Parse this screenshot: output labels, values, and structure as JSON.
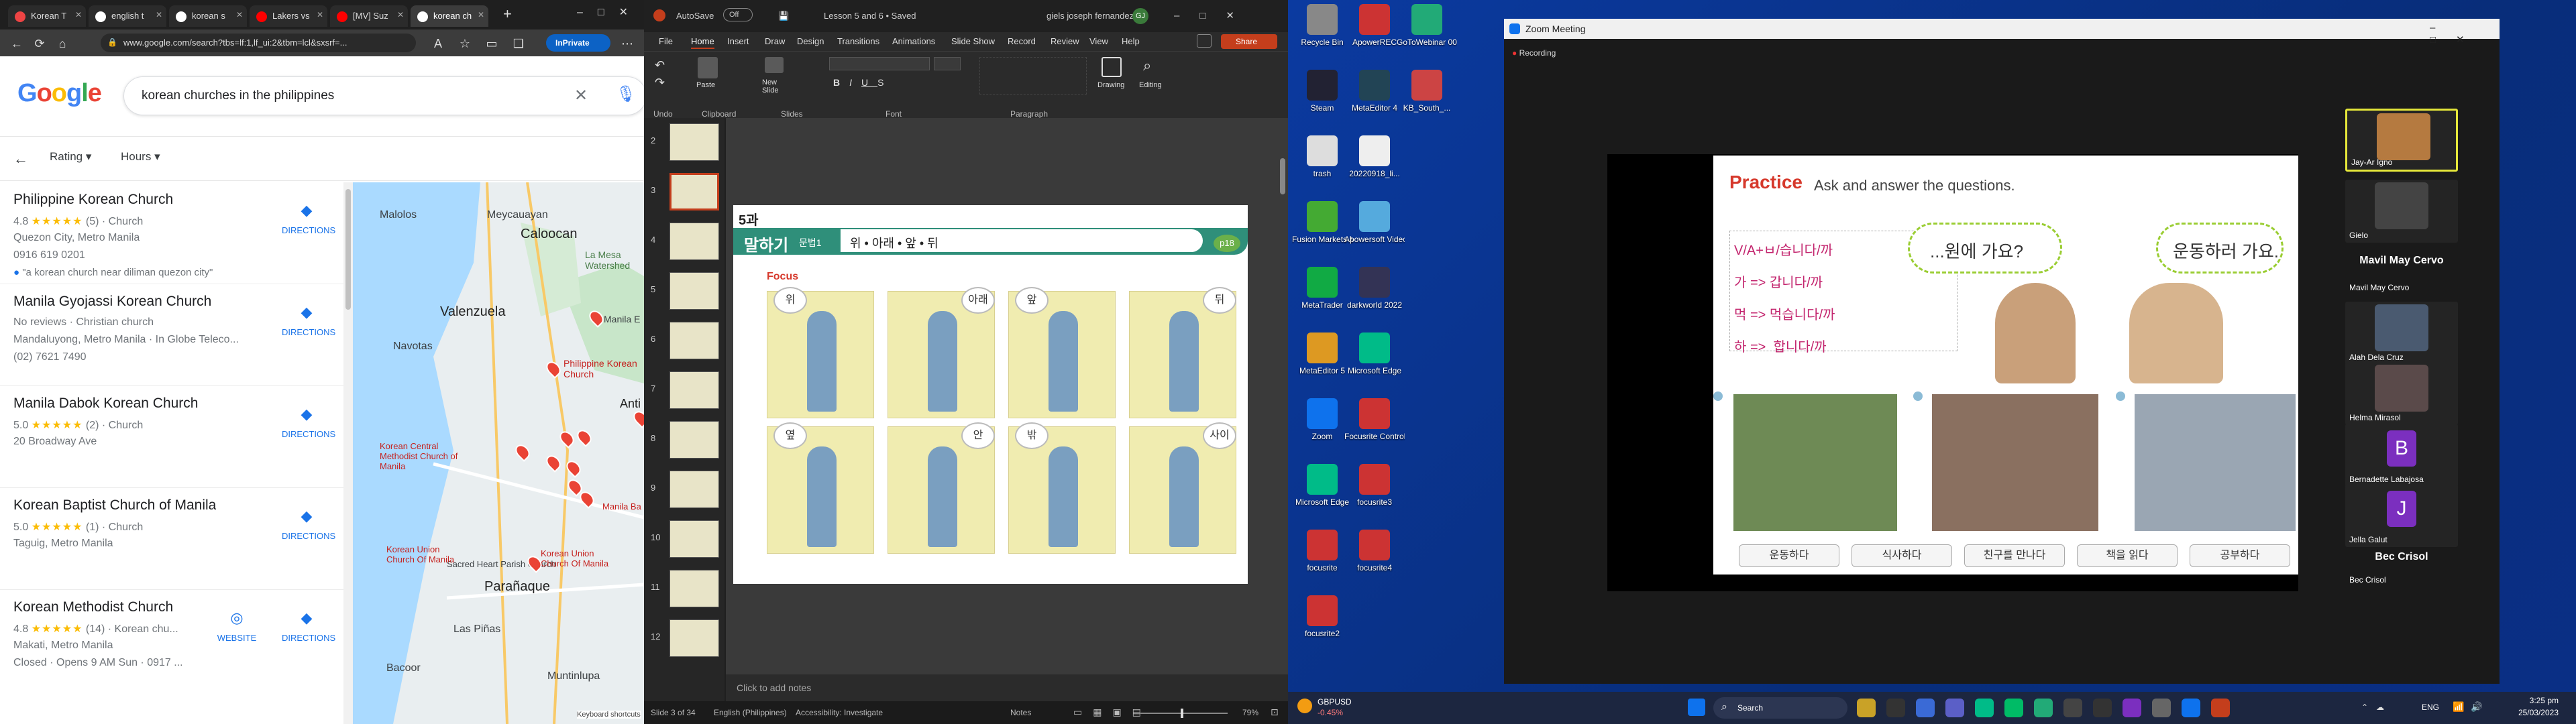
{
  "browser": {
    "tabs": [
      "Korean T",
      "english t",
      "korean s",
      "Lakers vs",
      "[MV] Suz",
      "korean ch"
    ],
    "url": "www.google.com/search?tbs=lf:1,lf_ui:2&tbm=lcl&sxsrf=...",
    "inprivate": "InPrivate",
    "google_logo": "Google",
    "query": "korean churches in the philippines",
    "filters": {
      "rating": "Rating",
      "hours": "Hours"
    },
    "results": [
      {
        "name": "Philippine Korean Church",
        "rating": "4.8",
        "stars": "★★★★★",
        "count": "(5)",
        "type": "Church",
        "address": "Quezon City, Metro Manila",
        "extra": "0916 619 0201",
        "snippet": "\"a korean church near diliman quezon city\"",
        "directions": "DIRECTIONS"
      },
      {
        "name": "Manila Gyojassi Korean Church",
        "rating": "No reviews",
        "stars": "",
        "count": "",
        "type": "Christian church",
        "address": "Mandaluyong, Metro Manila · In Globe Teleco...",
        "extra": "(02) 7621 7490",
        "snippet": "",
        "directions": "DIRECTIONS"
      },
      {
        "name": "Manila Dabok Korean Church",
        "rating": "5.0",
        "stars": "★★★★★",
        "count": "(2)",
        "type": "Church",
        "address": "20 Broadway Ave",
        "extra": "",
        "snippet": "",
        "directions": "DIRECTIONS"
      },
      {
        "name": "Korean Baptist Church of Manila",
        "rating": "5.0",
        "stars": "★★★★★",
        "count": "(1)",
        "type": "Church",
        "address": "Taguig, Metro Manila",
        "extra": "",
        "snippet": "",
        "directions": "DIRECTIONS"
      },
      {
        "name": "Korean Methodist Church",
        "rating": "4.8",
        "stars": "★★★★★",
        "count": "(14)",
        "type": "Korean chu...",
        "address": "Makati, Metro Manila",
        "extra": "Closed · Opens 9 AM Sun · 0917 ...",
        "snippet": "",
        "directions": "DIRECTIONS",
        "website": "WEBSITE"
      }
    ],
    "map_labels": [
      "Malolos",
      "Meycauayan",
      "Caloocan",
      "La Mesa Watershed",
      "Valenzuela",
      "Navotas",
      "Manila E",
      "Philippine Korean Church",
      "Anti",
      "Korean Central Methodist Church of Manila",
      "Manila Ba",
      "Sacred Heart Parish Church",
      "Korean Union Church Of Manila",
      "Korean Union Church Of Manila",
      "Parañaque",
      "Las Piñas",
      "Bacoor",
      "Muntinlupa",
      "Keyboard shortcuts"
    ]
  },
  "ppt": {
    "autosave": "AutoSave",
    "autosave_state": "Off",
    "doc_title": "Lesson 5 and 6 • Saved",
    "user": "giels joseph fernandez",
    "menu": [
      "File",
      "Home",
      "Insert",
      "Draw",
      "Design",
      "Transitions",
      "Animations",
      "Slide Show",
      "Record",
      "Review",
      "View",
      "Help"
    ],
    "share": "Share",
    "groups": [
      "Undo",
      "Clipboard",
      "Slides",
      "Font",
      "Paragraph",
      "Drawing",
      "Editing"
    ],
    "ribbon_btns": {
      "paste": "Paste",
      "new_slide": "New Slide",
      "drawing": "Drawing",
      "editing": "Editing"
    },
    "thumb_numbers": [
      "2",
      "3",
      "4",
      "5",
      "6",
      "7",
      "8",
      "9",
      "10",
      "11",
      "12"
    ],
    "slide": {
      "lesson_no": "5과",
      "header_ko": "말하기",
      "header_sub": "문법1",
      "header_words": "위 • 아래 • 앞 • 뒤",
      "page": "p18",
      "focus": "Focus",
      "bubbles_top": [
        "위",
        "아래",
        "앞",
        "뒤"
      ],
      "bubbles_bottom": [
        "옆",
        "안",
        "밖",
        "사이"
      ]
    },
    "notes": "Click to add notes",
    "status": {
      "slide": "Slide 3 of 34",
      "lang": "English (Philippines)",
      "access": "Accessibility: Investigate",
      "notes": "Notes",
      "zoom": "79%"
    }
  },
  "desktop": {
    "icons": [
      "Recycle Bin",
      "ApowerREC",
      "GoToWebinar 001",
      "Steam",
      "MetaEditor 4",
      "KB_South_...",
      "trash",
      "20220918_li...",
      "Fusion Markets M...",
      "Apowersoft Video Co...",
      "MetaTrader",
      "darkworld 2022",
      "MetaEditor 5",
      "Microsoft Edge",
      "Zoom",
      "Focusrite Control",
      "Microsoft Edge",
      "focusrite3",
      "focusrite",
      "focusrite4",
      "focusrite2"
    ]
  },
  "zoom": {
    "title": "Zoom Meeting",
    "recording": "Recording",
    "slide": {
      "practice": "Practice",
      "instruction": "Ask and answer the questions.",
      "grammar": [
        "V/A+ㅂ/습니다/까",
        "가 => 갑니다/까",
        "먹 => 먹습니다/까",
        "하 =>  합니다/까"
      ],
      "bubble_left": "...원에 가요?",
      "bubble_right": "운동하러 가요.",
      "captions": [
        "운동하다",
        "식사하다",
        "친구를 만나다",
        "책을 읽다",
        "공부하다"
      ]
    },
    "participants": [
      "Jay-Ar Igno",
      "Gielo",
      "Mavil May Cervo",
      "Alah Dela Cruz",
      "Helma Mirasol",
      "Bernadette Labajosa",
      "Jella Galut",
      "Bec Crisol"
    ],
    "big_names": [
      "Mavil May Cervo",
      "Bec Crisol"
    ],
    "initials": [
      "B",
      "J"
    ]
  },
  "taskbar": {
    "ticker": "GBPUSD",
    "ticker_change": "-0.45%",
    "search": "Search",
    "lang": "ENG",
    "time": "3:25 pm",
    "date": "25/03/2023"
  },
  "colors": {
    "accent": "#1a73e8",
    "pptRed": "#c43e1c",
    "zoomBlue": "#0e72ed",
    "slideGreen": "#2f8f7a"
  }
}
